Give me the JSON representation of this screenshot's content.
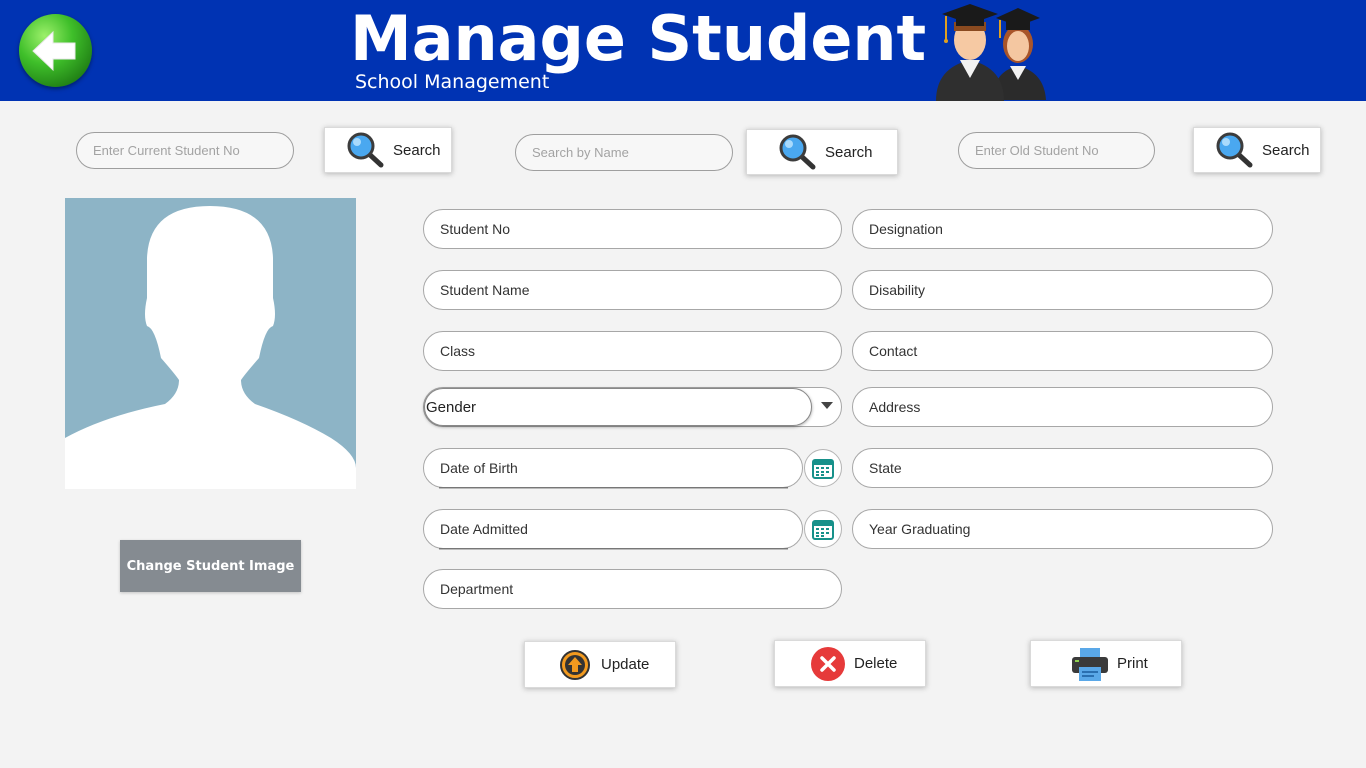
{
  "header": {
    "title": "Manage Student",
    "subtitle": "School Management",
    "bg_color": "#0033b3"
  },
  "search": {
    "current": {
      "placeholder": "Enter Current Student No",
      "button_label": "Search"
    },
    "name": {
      "placeholder": "Search by Name",
      "button_label": "Search"
    },
    "old": {
      "placeholder": "Enter Old Student No",
      "button_label": "Search"
    }
  },
  "photo": {
    "change_label": "Change Student Image",
    "bg_color": "#8db4c6"
  },
  "form": {
    "student_no": "Student No",
    "student_name": "Student Name",
    "class": "Class",
    "gender": "Gender",
    "date_of_birth": "Date of Birth",
    "date_admitted": "Date Admitted",
    "department": "Department",
    "designation": "Designation",
    "disability": "Disability",
    "contact": "Contact",
    "address": "Address",
    "state": "State",
    "year_graduating": "Year Graduating"
  },
  "actions": {
    "update": "Update",
    "delete": "Delete",
    "print": "Print"
  },
  "icons": {
    "back": "back-arrow-icon",
    "search": "magnifier-icon",
    "calendar": "calendar-icon",
    "update": "upload-arrow-icon",
    "delete": "close-circle-icon",
    "print": "printer-icon"
  }
}
